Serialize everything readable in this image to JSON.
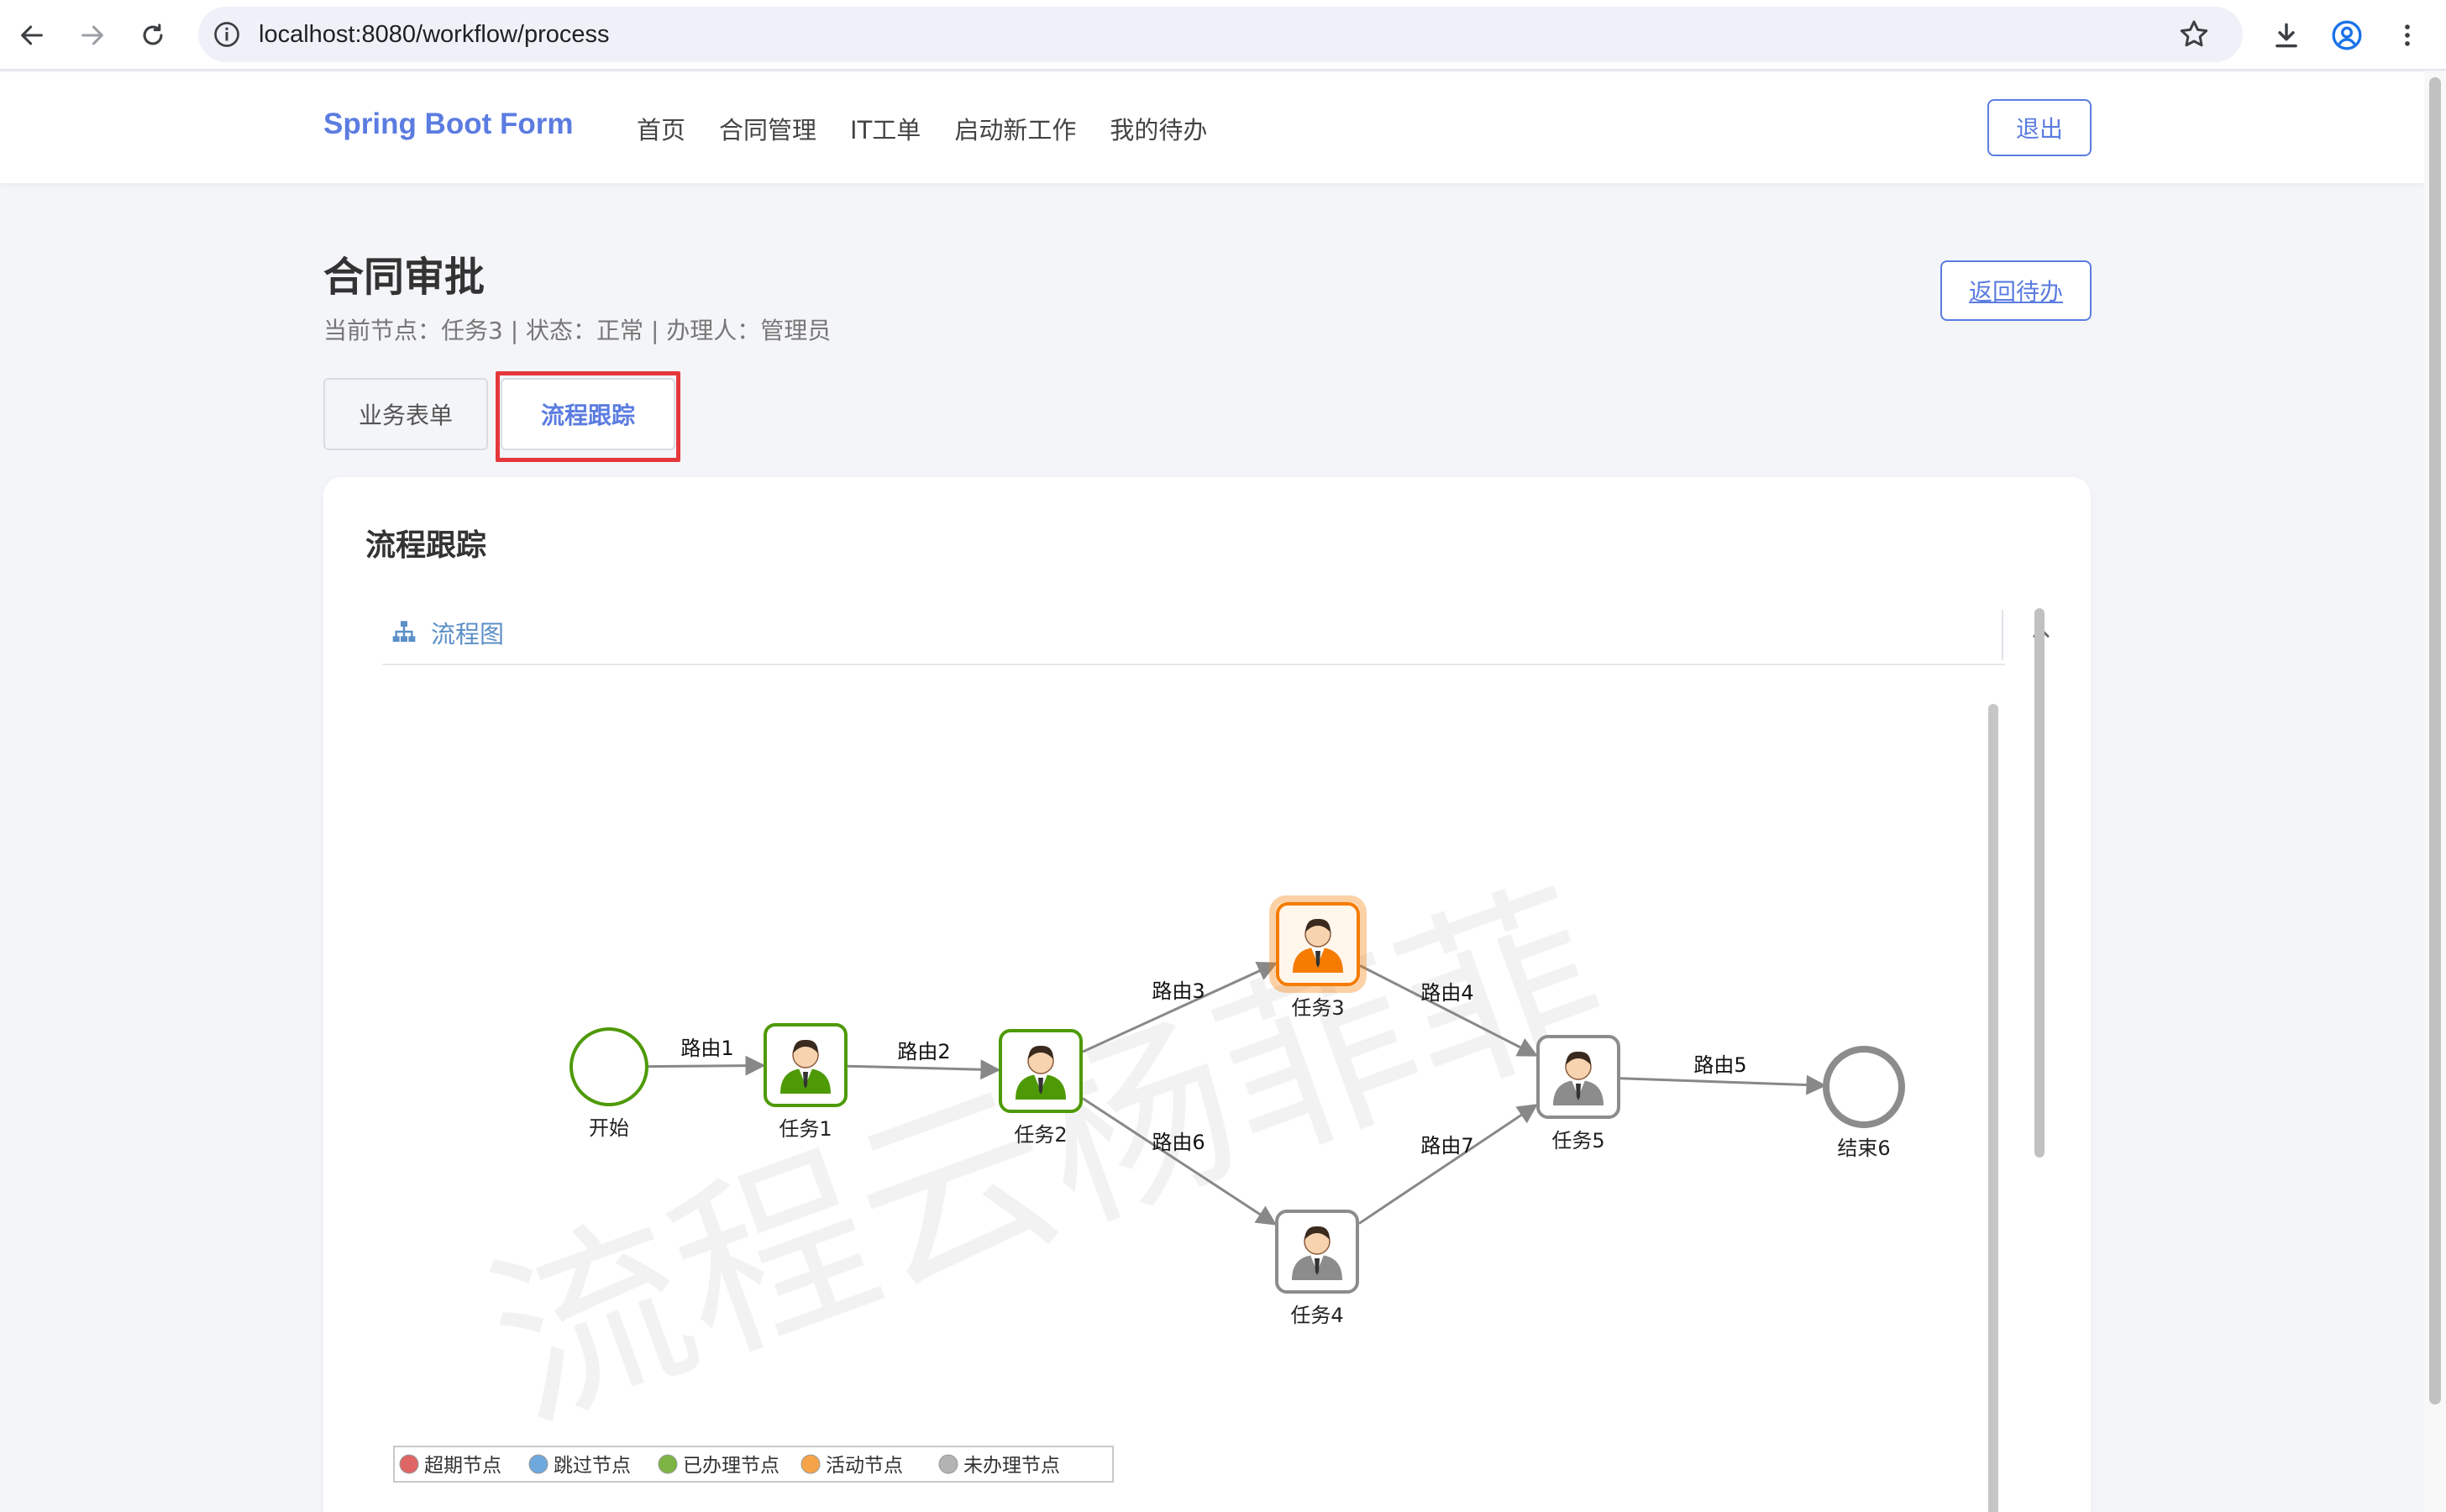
{
  "browser": {
    "url": "localhost:8080/workflow/process"
  },
  "header": {
    "brand": "Spring Boot Form",
    "menu": [
      "首页",
      "合同管理",
      "IT工单",
      "启动新工作",
      "我的待办"
    ],
    "logout": "退出"
  },
  "page": {
    "title": "合同审批",
    "subtitle": "当前节点：任务3 | 状态：正常 | 办理人：管理员",
    "back_button": "返回待办"
  },
  "tabs": [
    {
      "label": "业务表单",
      "active": false
    },
    {
      "label": "流程跟踪",
      "active": true
    }
  ],
  "card": {
    "title": "流程跟踪",
    "panel_label": "流程图"
  },
  "diagram": {
    "watermark": "流程云杨菲菲",
    "nodes": [
      {
        "id": "start",
        "label": "开始",
        "kind": "start",
        "status": "done"
      },
      {
        "id": "t1",
        "label": "任务1",
        "kind": "task",
        "status": "done"
      },
      {
        "id": "t2",
        "label": "任务2",
        "kind": "task",
        "status": "done"
      },
      {
        "id": "t3",
        "label": "任务3",
        "kind": "task",
        "status": "active"
      },
      {
        "id": "t4",
        "label": "任务4",
        "kind": "task",
        "status": "pending"
      },
      {
        "id": "t5",
        "label": "任务5",
        "kind": "task",
        "status": "pending"
      },
      {
        "id": "end",
        "label": "结束6",
        "kind": "end",
        "status": "pending"
      }
    ],
    "edges": [
      {
        "from": "start",
        "to": "t1",
        "label": "路由1"
      },
      {
        "from": "t1",
        "to": "t2",
        "label": "路由2"
      },
      {
        "from": "t2",
        "to": "t3",
        "label": "路由3"
      },
      {
        "from": "t3",
        "to": "t5",
        "label": "路由4"
      },
      {
        "from": "t5",
        "to": "end",
        "label": "路由5"
      },
      {
        "from": "t2",
        "to": "t4",
        "label": "路由6"
      },
      {
        "from": "t4",
        "to": "t5",
        "label": "路由7"
      }
    ],
    "legend": [
      {
        "label": "超期节点",
        "color": "#e06666"
      },
      {
        "label": "跳过节点",
        "color": "#6fa8dc"
      },
      {
        "label": "已办理节点",
        "color": "#7cb342"
      },
      {
        "label": "活动节点",
        "color": "#f6a44a"
      },
      {
        "label": "未办理节点",
        "color": "#b3b3b3"
      }
    ],
    "status_colors": {
      "done": "#4e9a06",
      "active": "#f57c00",
      "pending": "#8c8c8c"
    }
  }
}
